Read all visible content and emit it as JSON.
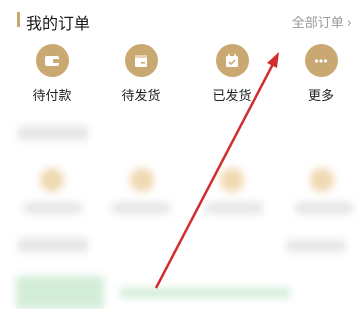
{
  "header": {
    "title": "我的订单",
    "all_orders": "全部订单",
    "chevron": "›"
  },
  "statuses": [
    {
      "label": "待付款",
      "icon": "wallet-icon"
    },
    {
      "label": "待发货",
      "icon": "box-icon"
    },
    {
      "label": "已发货",
      "icon": "calendar-check-icon"
    },
    {
      "label": "更多",
      "icon": "more-dots-icon"
    }
  ],
  "colors": {
    "accent": "#c8a86b",
    "icon_bg": "#c9a871",
    "arrow": "#d22d2d"
  }
}
